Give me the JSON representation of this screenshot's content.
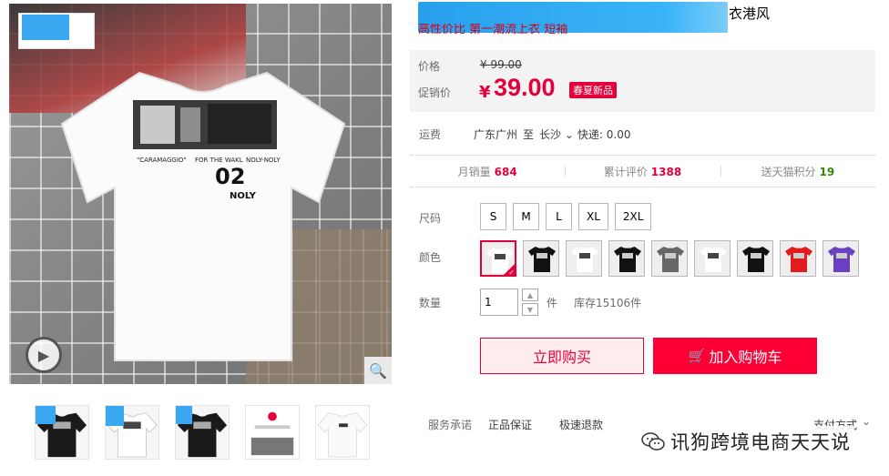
{
  "gallery": {
    "shirt_print_text": "02",
    "shirt_brand": "NOLY",
    "shirt_caption_1": "\"CARAMAGGIO\"",
    "shirt_caption_2": "FOR THE WAKL",
    "shirt_caption_3": "NOLY-NOLY",
    "play_icon": "play-icon",
    "zoom_icon": "zoom-icon",
    "thumbs": [
      {
        "color": "#1a1a1a"
      },
      {
        "color": "#ffffff"
      },
      {
        "color": "#1a1a1a"
      },
      {
        "color": "#ffffff"
      },
      {
        "color": "#ffffff"
      }
    ]
  },
  "product": {
    "title_tail": "衣港风",
    "subtitle": "高性价比 第一潮流上衣 短袖"
  },
  "price": {
    "price_label": "价格",
    "old_price": "¥ 99.00",
    "promo_label": "促销价",
    "currency": "¥",
    "promo_price": "39.00",
    "promo_tag": "春夏新品"
  },
  "shipping": {
    "label": "运费",
    "from": "广东广州",
    "to_word": "至",
    "city": "长沙",
    "fee": "快递: 0.00"
  },
  "stats": {
    "monthly_label": "月销量",
    "monthly_value": "684",
    "reviews_label": "累计评价",
    "reviews_value": "1388",
    "points_label": "送天猫积分",
    "points_value": "19"
  },
  "sku": {
    "size_label": "尺码",
    "sizes": [
      "S",
      "M",
      "L",
      "XL",
      "2XL"
    ],
    "color_label": "颜色",
    "colors": [
      {
        "shirt": "#ffffff",
        "selected": true
      },
      {
        "shirt": "#111111"
      },
      {
        "shirt": "#ffffff"
      },
      {
        "shirt": "#111111"
      },
      {
        "shirt": "#666666"
      },
      {
        "shirt": "#ffffff"
      },
      {
        "shirt": "#111111"
      },
      {
        "shirt": "#e21c1c"
      },
      {
        "shirt": "#6a3fc0"
      }
    ]
  },
  "quantity": {
    "label": "数量",
    "value": "1",
    "unit": "件",
    "stock": "库存15106件"
  },
  "actions": {
    "buy_now": "立即购买",
    "add_cart": "加入购物车"
  },
  "promise": {
    "label": "服务承诺",
    "items": [
      "正品保证",
      "极速退款"
    ],
    "payment": "支付方式"
  },
  "watermark": {
    "text": "讯狗跨境电商天天说"
  },
  "colors": {
    "accent": "#e4003a",
    "cart_button": "#ff0036",
    "redaction": "#3aa8f0"
  }
}
